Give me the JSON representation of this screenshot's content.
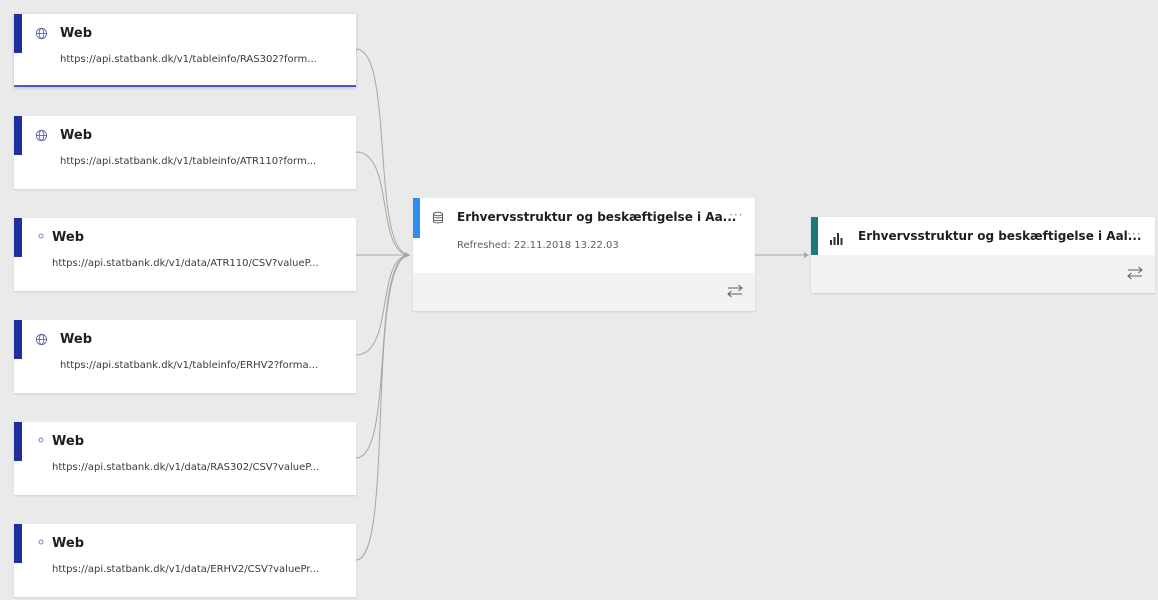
{
  "sources": [
    {
      "icon": "globe-icon",
      "title": "Web",
      "url": "https://api.statbank.dk/v1/tableinfo/RAS302?form..."
    },
    {
      "icon": "globe-icon",
      "title": "Web",
      "url": "https://api.statbank.dk/v1/tableinfo/ATR110?form..."
    },
    {
      "icon": "dot-icon",
      "title": "Web",
      "url": "https://api.statbank.dk/v1/data/ATR110/CSV?valueP..."
    },
    {
      "icon": "globe-icon",
      "title": "Web",
      "url": "https://api.statbank.dk/v1/tableinfo/ERHV2?forma..."
    },
    {
      "icon": "dot-icon",
      "title": "Web",
      "url": "https://api.statbank.dk/v1/data/RAS302/CSV?valueP..."
    },
    {
      "icon": "dot-icon",
      "title": "Web",
      "url": "https://api.statbank.dk/v1/data/ERHV2/CSV?valuePr..."
    }
  ],
  "dataset": {
    "icon": "database-icon",
    "title": "Erhvervsstruktur og beskæftigelse i Aa...",
    "refreshed": "Refreshed: 22.11.2018 13.22.03",
    "more": "···",
    "swap_icon": "swap-arrows-icon"
  },
  "report": {
    "icon": "bar-chart-icon",
    "title": "Erhvervsstruktur og beskæftigelse i Aal...",
    "more": "···",
    "swap_icon": "swap-arrows-icon"
  },
  "colors": {
    "source_accent": "#1f2fa0",
    "dataset_accent": "#2c8ff0",
    "report_accent": "#1a7a7a",
    "canvas": "#eaeaea"
  }
}
